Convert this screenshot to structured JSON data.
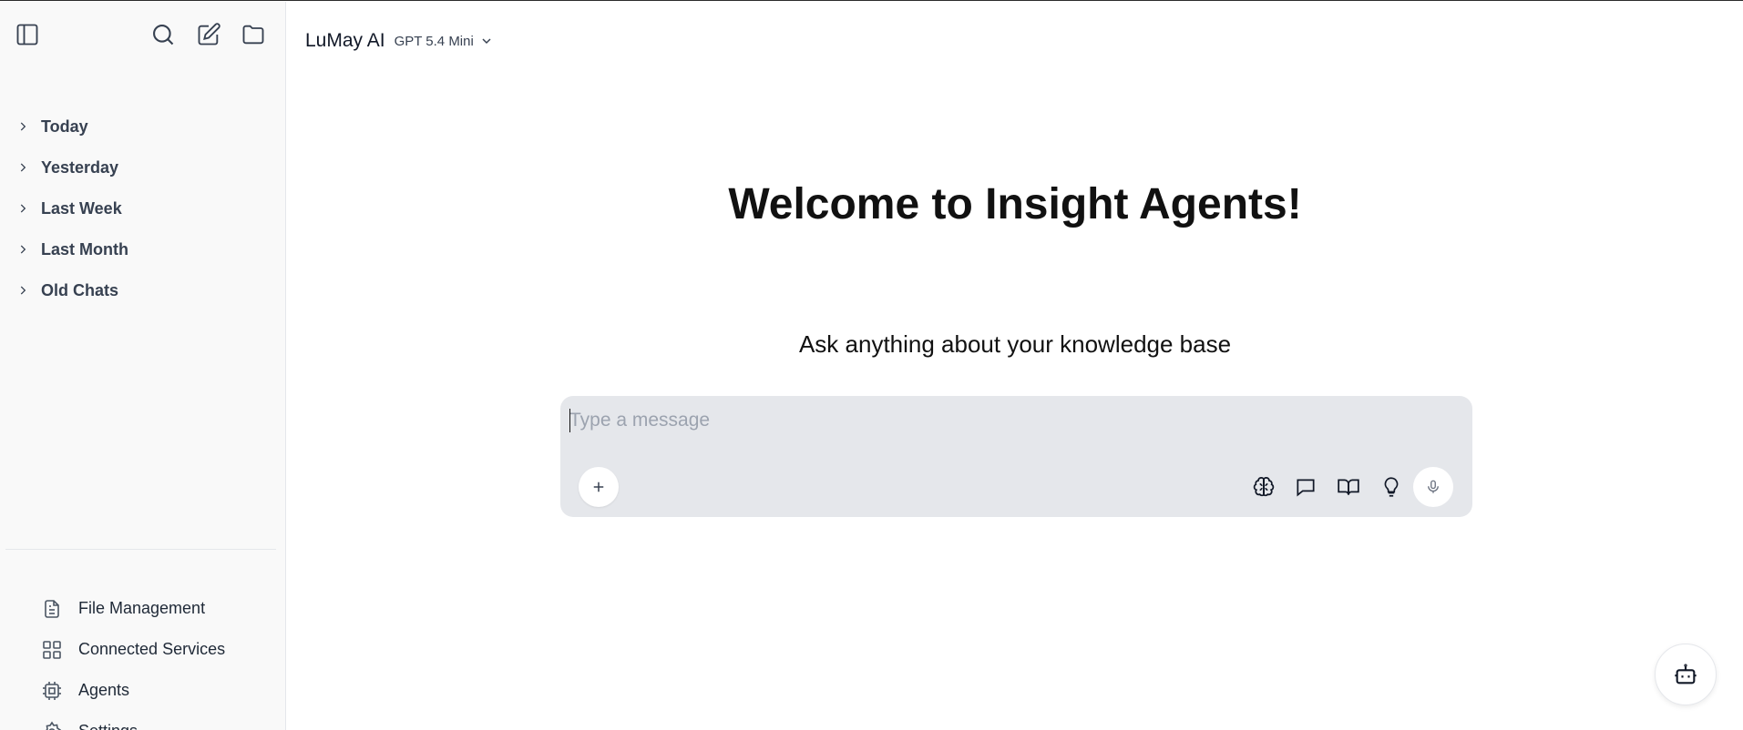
{
  "sidebar": {
    "toggle_icon": "sidebar-toggle-icon",
    "search_icon": "search-icon",
    "new_chat_icon": "edit-icon",
    "folder_icon": "folder-icon",
    "history_groups": [
      {
        "label": "Today"
      },
      {
        "label": "Yesterday"
      },
      {
        "label": "Last Week"
      },
      {
        "label": "Last Month"
      },
      {
        "label": "Old Chats"
      }
    ],
    "nav": [
      {
        "label": "File Management",
        "icon": "file-icon"
      },
      {
        "label": "Connected Services",
        "icon": "grid-icon"
      },
      {
        "label": "Agents",
        "icon": "cpu-icon"
      },
      {
        "label": "Settings",
        "icon": "gear-icon"
      }
    ]
  },
  "header": {
    "app_title": "LuMay AI",
    "model": "GPT 5.4 Mini"
  },
  "main": {
    "welcome": "Welcome to Insight Agents!",
    "subtitle": "Ask anything about your knowledge base"
  },
  "composer": {
    "placeholder": "Type a message",
    "value": "",
    "tools": [
      "brain-icon",
      "chat-icon",
      "book-icon",
      "lightbulb-icon",
      "mic-icon"
    ]
  },
  "colors": {
    "sidebar_bg": "#f9f9f9",
    "composer_bg": "#e5e7eb",
    "text": "#111827"
  }
}
